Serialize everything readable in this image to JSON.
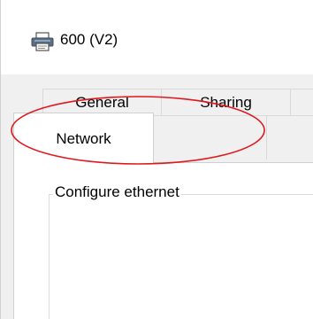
{
  "window": {
    "title": "600 (V2)",
    "icon": "printer-icon"
  },
  "tabs": {
    "general": "General",
    "sharing": "Sharing",
    "network": "Network",
    "selected": "Network"
  },
  "groupbox": {
    "title": "Configure ethernet"
  },
  "annotation": {
    "shape": "ellipse",
    "color": "#e0181d",
    "target": "tab-network"
  },
  "colors": {
    "dialog_bg": "#f0f0f0",
    "content_bg": "#ffffff",
    "border": "#d9d9d9",
    "highlight": "#e0181d"
  }
}
